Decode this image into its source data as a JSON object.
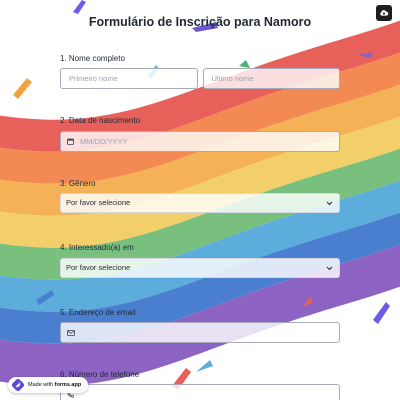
{
  "form": {
    "title": "Formulário de Inscrição para Namoro",
    "fields": [
      {
        "label": "1.  Nome completo",
        "first_placeholder": "Primeiro nome",
        "last_placeholder": "Último nome"
      },
      {
        "label": "2.  Data de nascimento",
        "placeholder": "MM/DD/YYYY"
      },
      {
        "label": "3.  Gênero",
        "selected": "Por favor selecione"
      },
      {
        "label": "4.  Interessado(a) em",
        "selected": "Por favor selecione"
      },
      {
        "label": "5.  Endereço de email",
        "placeholder": ""
      },
      {
        "label": "6.  Número de telefone"
      }
    ]
  },
  "badge": {
    "prefix": "Made with ",
    "brand": "forms.app"
  },
  "icons": {
    "save": "cloud-save-icon",
    "calendar": "calendar-icon",
    "email": "envelope-icon",
    "phone": "phone-icon",
    "chevron": "chevron-down-icon",
    "brand": "forms-app-logo-icon"
  },
  "colors": {
    "stripes": [
      "#e8605a",
      "#f48a53",
      "#f5b155",
      "#f3cf6a",
      "#79c07e",
      "#5cacdc",
      "#4a7fd0",
      "#8c63c2"
    ],
    "input_border": "#a7a9bd",
    "title": "#1f2933"
  }
}
